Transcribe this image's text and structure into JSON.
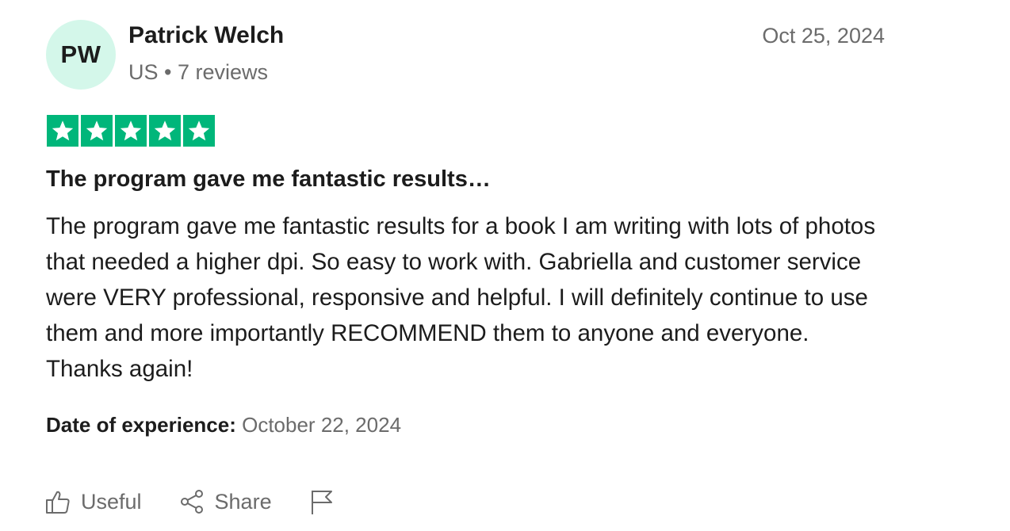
{
  "reviewer": {
    "initials": "PW",
    "name": "Patrick Welch",
    "country": "US",
    "separator": "•",
    "review_count": "7 reviews"
  },
  "review": {
    "date": "Oct 25, 2024",
    "rating": 5,
    "max_rating": 5,
    "title": "The program gave me fantastic results…",
    "body": "The program gave me fantastic results for a book I am writing with lots of photos that needed a higher dpi. So easy to work with. Gabriella and customer service were VERY professional, responsive and helpful. I will definitely continue to use them and more importantly RECOMMEND them to anyone and everyone. Thanks again!",
    "experience_label": "Date of experience:",
    "experience_date": "October 22, 2024"
  },
  "actions": {
    "useful_label": "Useful",
    "share_label": "Share"
  },
  "icons": {
    "useful": "thumbs-up-icon",
    "share": "share-icon",
    "report": "flag-icon",
    "star": "star-icon"
  },
  "colors": {
    "star_green": "#00b67a",
    "avatar_bg": "#d4f7ea",
    "muted_text": "#6b6b6b",
    "primary_text": "#1c1c1c"
  }
}
